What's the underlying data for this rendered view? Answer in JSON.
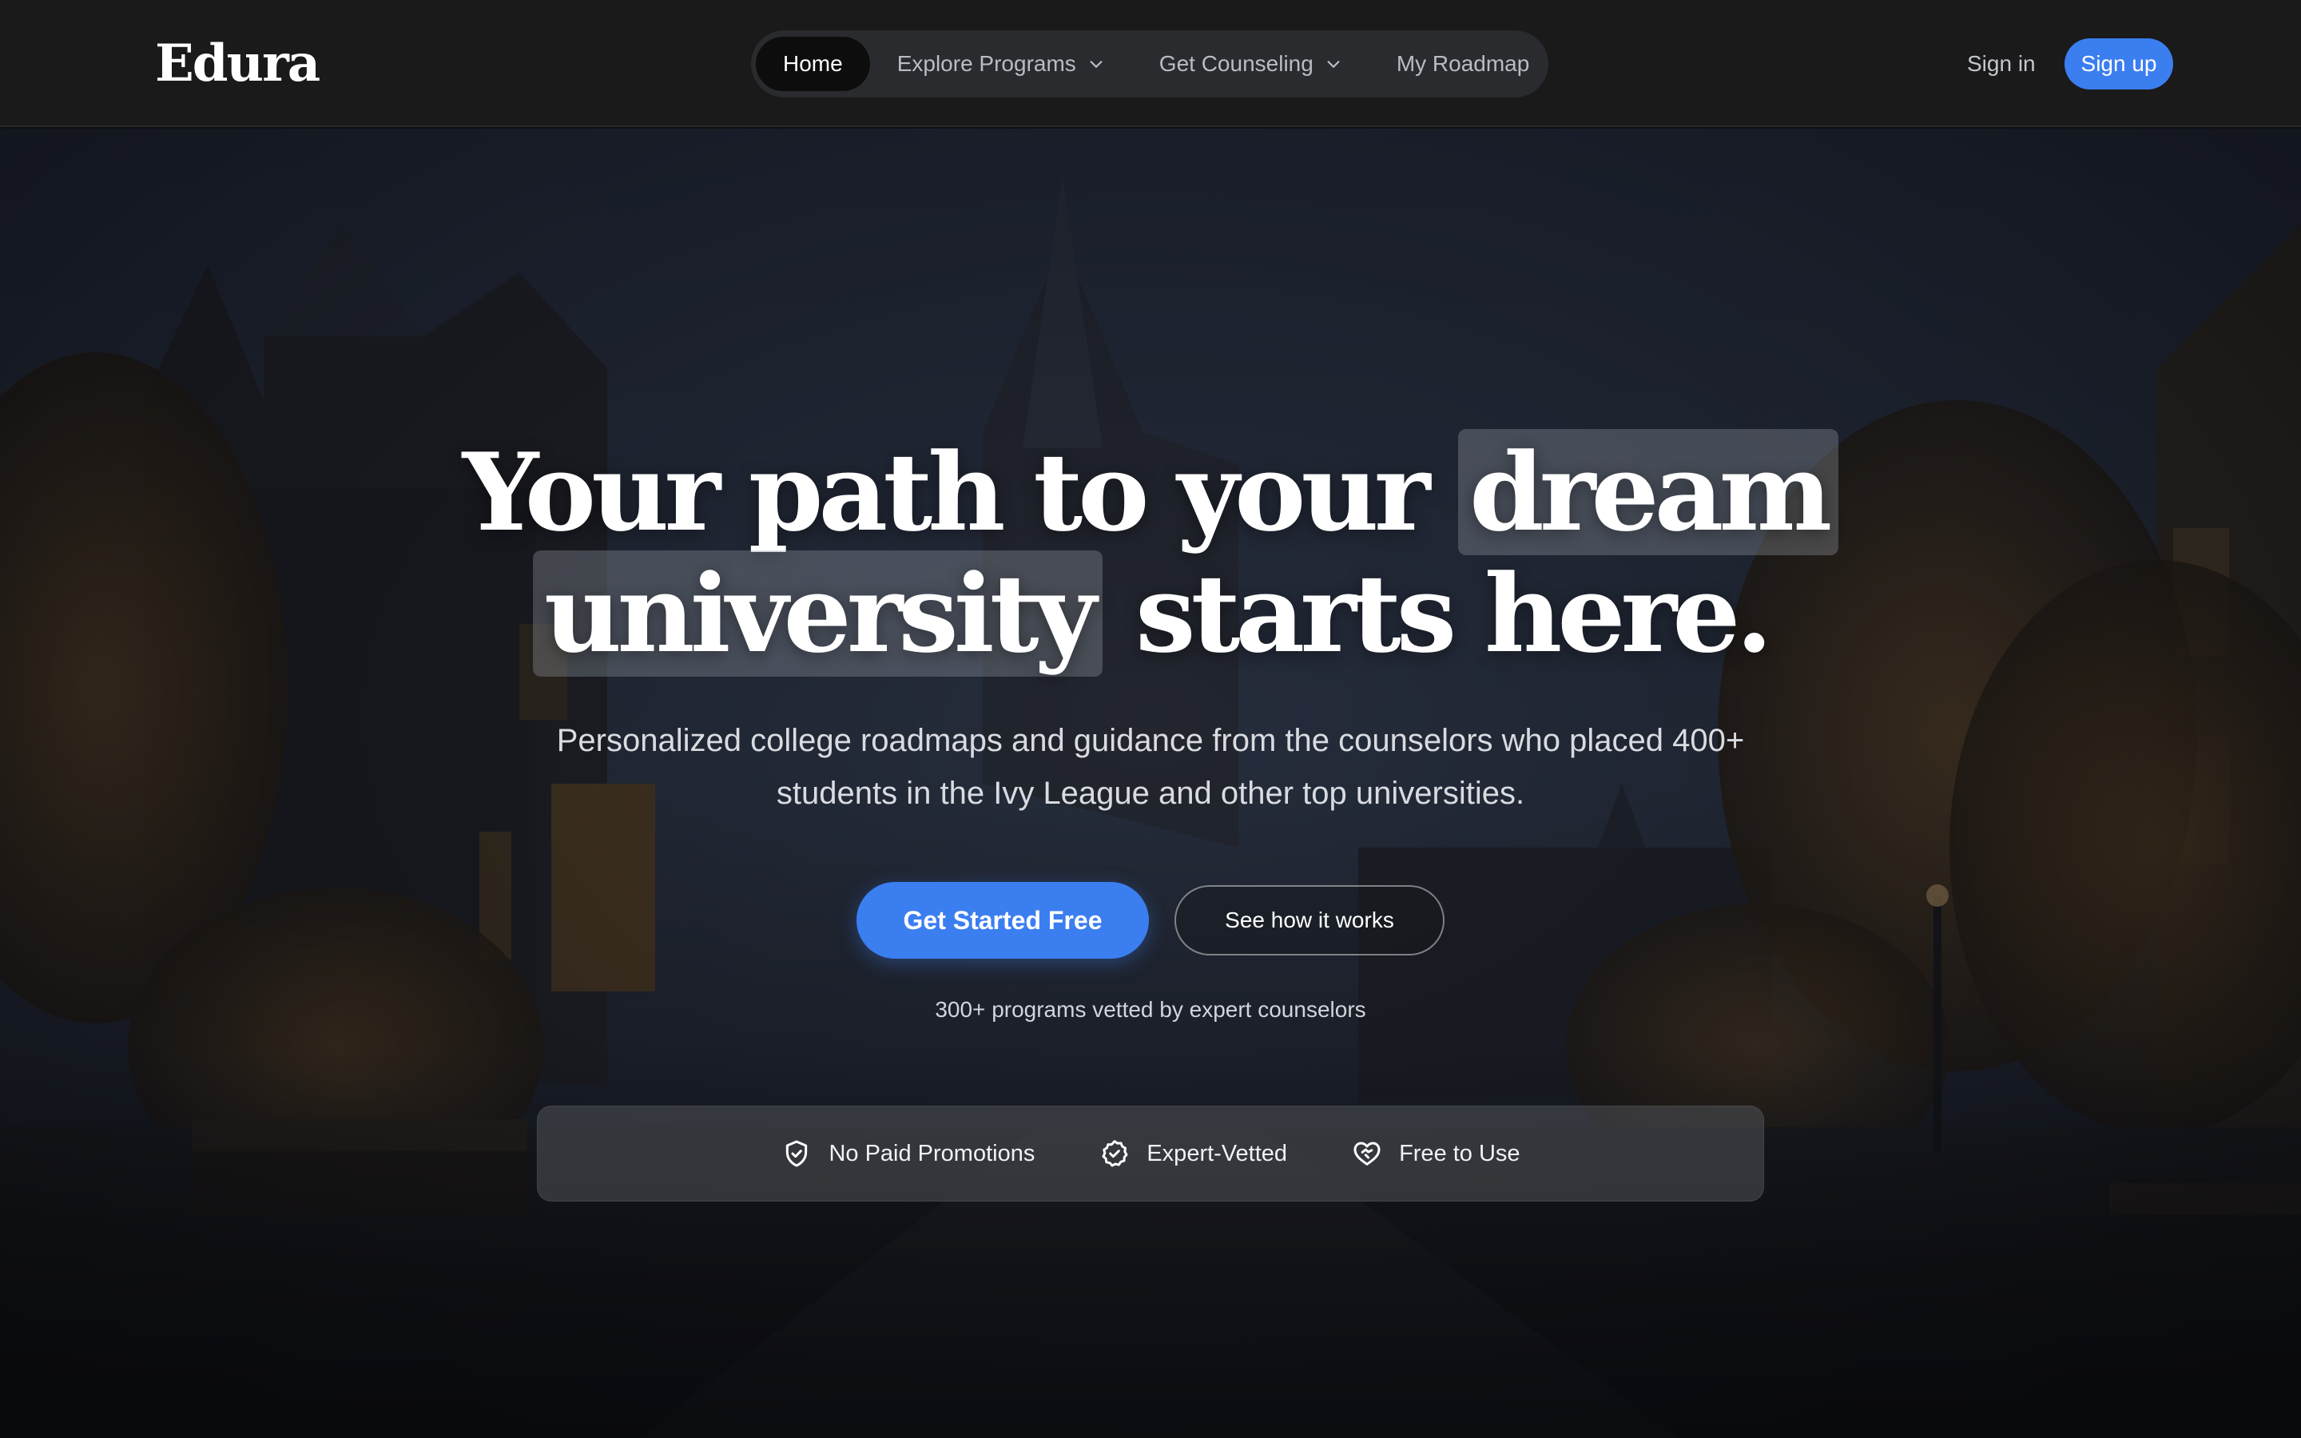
{
  "brand": {
    "logo": "Edura",
    "accent": "#3b7ef0"
  },
  "nav": {
    "items": [
      {
        "label": "Home",
        "active": true,
        "dropdown": false
      },
      {
        "label": "Explore Programs",
        "active": false,
        "dropdown": true
      },
      {
        "label": "Get Counseling",
        "active": false,
        "dropdown": true
      },
      {
        "label": "My Roadmap",
        "active": false,
        "dropdown": false
      }
    ],
    "signin": "Sign in",
    "signup": "Sign up"
  },
  "hero": {
    "headline": {
      "line1_a": "Your path to your",
      "line1_highlight": "dream",
      "line2_highlight": "university",
      "line2_b": "starts here."
    },
    "subheadline": "Personalized college roadmaps and guidance from the counselors who placed 400+ students in the Ivy League and other top universities.",
    "cta_primary": "Get Started Free",
    "cta_secondary": "See how it works",
    "social_proof": "300+ programs vetted by expert counselors"
  },
  "trust": [
    {
      "icon": "shield-check-icon",
      "label": "No Paid Promotions"
    },
    {
      "icon": "badge-check-icon",
      "label": "Expert-Vetted"
    },
    {
      "icon": "heart-handshake-icon",
      "label": "Free to Use"
    }
  ]
}
